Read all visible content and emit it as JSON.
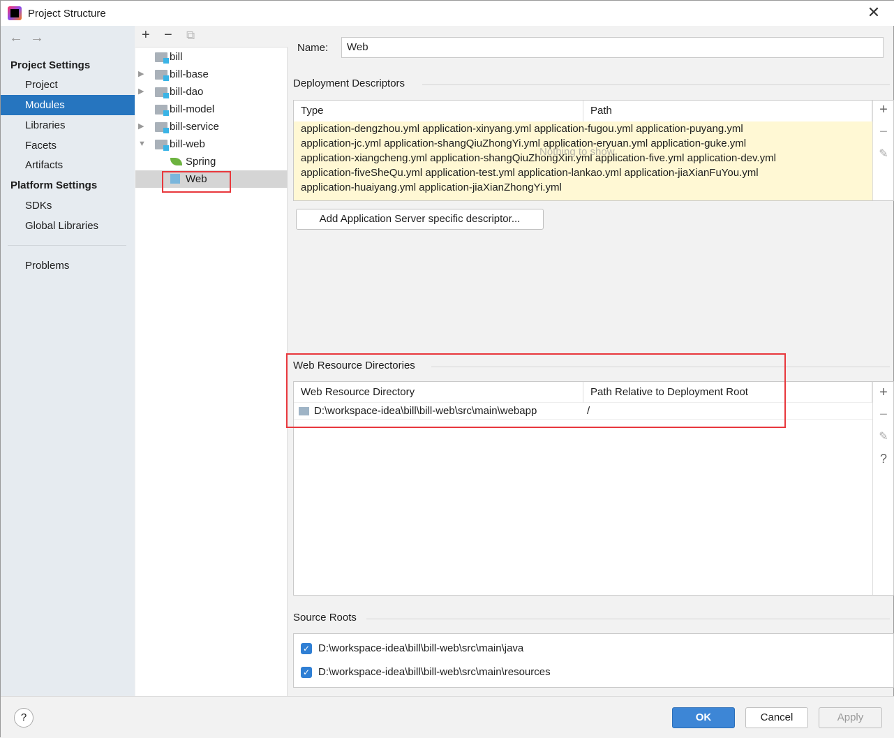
{
  "window": {
    "title": "Project Structure"
  },
  "sidebar": {
    "section1": "Project Settings",
    "items1": [
      "Project",
      "Modules",
      "Libraries",
      "Facets",
      "Artifacts"
    ],
    "section2": "Platform Settings",
    "items2": [
      "SDKs",
      "Global Libraries"
    ],
    "problems": "Problems",
    "selected": "Modules"
  },
  "tree": {
    "nodes": [
      {
        "label": "bill",
        "expand": ""
      },
      {
        "label": "bill-base",
        "expand": "▶"
      },
      {
        "label": "bill-dao",
        "expand": "▶"
      },
      {
        "label": "bill-model",
        "expand": ""
      },
      {
        "label": "bill-service",
        "expand": "▶"
      },
      {
        "label": "bill-web",
        "expand": "▼"
      }
    ],
    "children": [
      "Spring",
      "Web"
    ]
  },
  "main": {
    "name_label": "Name:",
    "name_value": "Web",
    "deployment": {
      "title": "Deployment Descriptors",
      "columns": [
        "Type",
        "Path"
      ],
      "lines": [
        "application-dengzhou.yml application-xinyang.yml application-fugou.yml application-puyang.yml",
        "application-jc.yml application-shangQiuZhongYi.yml application-eryuan.yml application-guke.yml",
        "application-xiangcheng.yml application-shangQiuZhongXin.yml application-five.yml application-dev.yml",
        "application-fiveSheQu.yml application-test.yml application-lankao.yml application-jiaXianFuYou.yml",
        "application-huaiyang.yml application-jiaXianZhongYi.yml"
      ],
      "empty": "Nothing to show",
      "add_button": "Add Application Server specific descriptor..."
    },
    "web_resources": {
      "title": "Web Resource Directories",
      "columns": [
        "Web Resource Directory",
        "Path Relative to Deployment Root"
      ],
      "rows": [
        {
          "dir": "D:\\workspace-idea\\bill\\bill-web\\src\\main\\webapp",
          "path": "/"
        }
      ]
    },
    "source_roots": {
      "title": "Source Roots",
      "items": [
        {
          "path": "D:\\workspace-idea\\bill\\bill-web\\src\\main\\java",
          "checked": true
        },
        {
          "path": "D:\\workspace-idea\\bill\\bill-web\\src\\main\\resources",
          "checked": true
        }
      ]
    }
  },
  "footer": {
    "ok": "OK",
    "cancel": "Cancel",
    "apply": "Apply",
    "help": "?"
  },
  "colors": {
    "accent": "#2675bf",
    "highlight": "#e8383d",
    "descriptor_bg": "#fff8d4"
  }
}
